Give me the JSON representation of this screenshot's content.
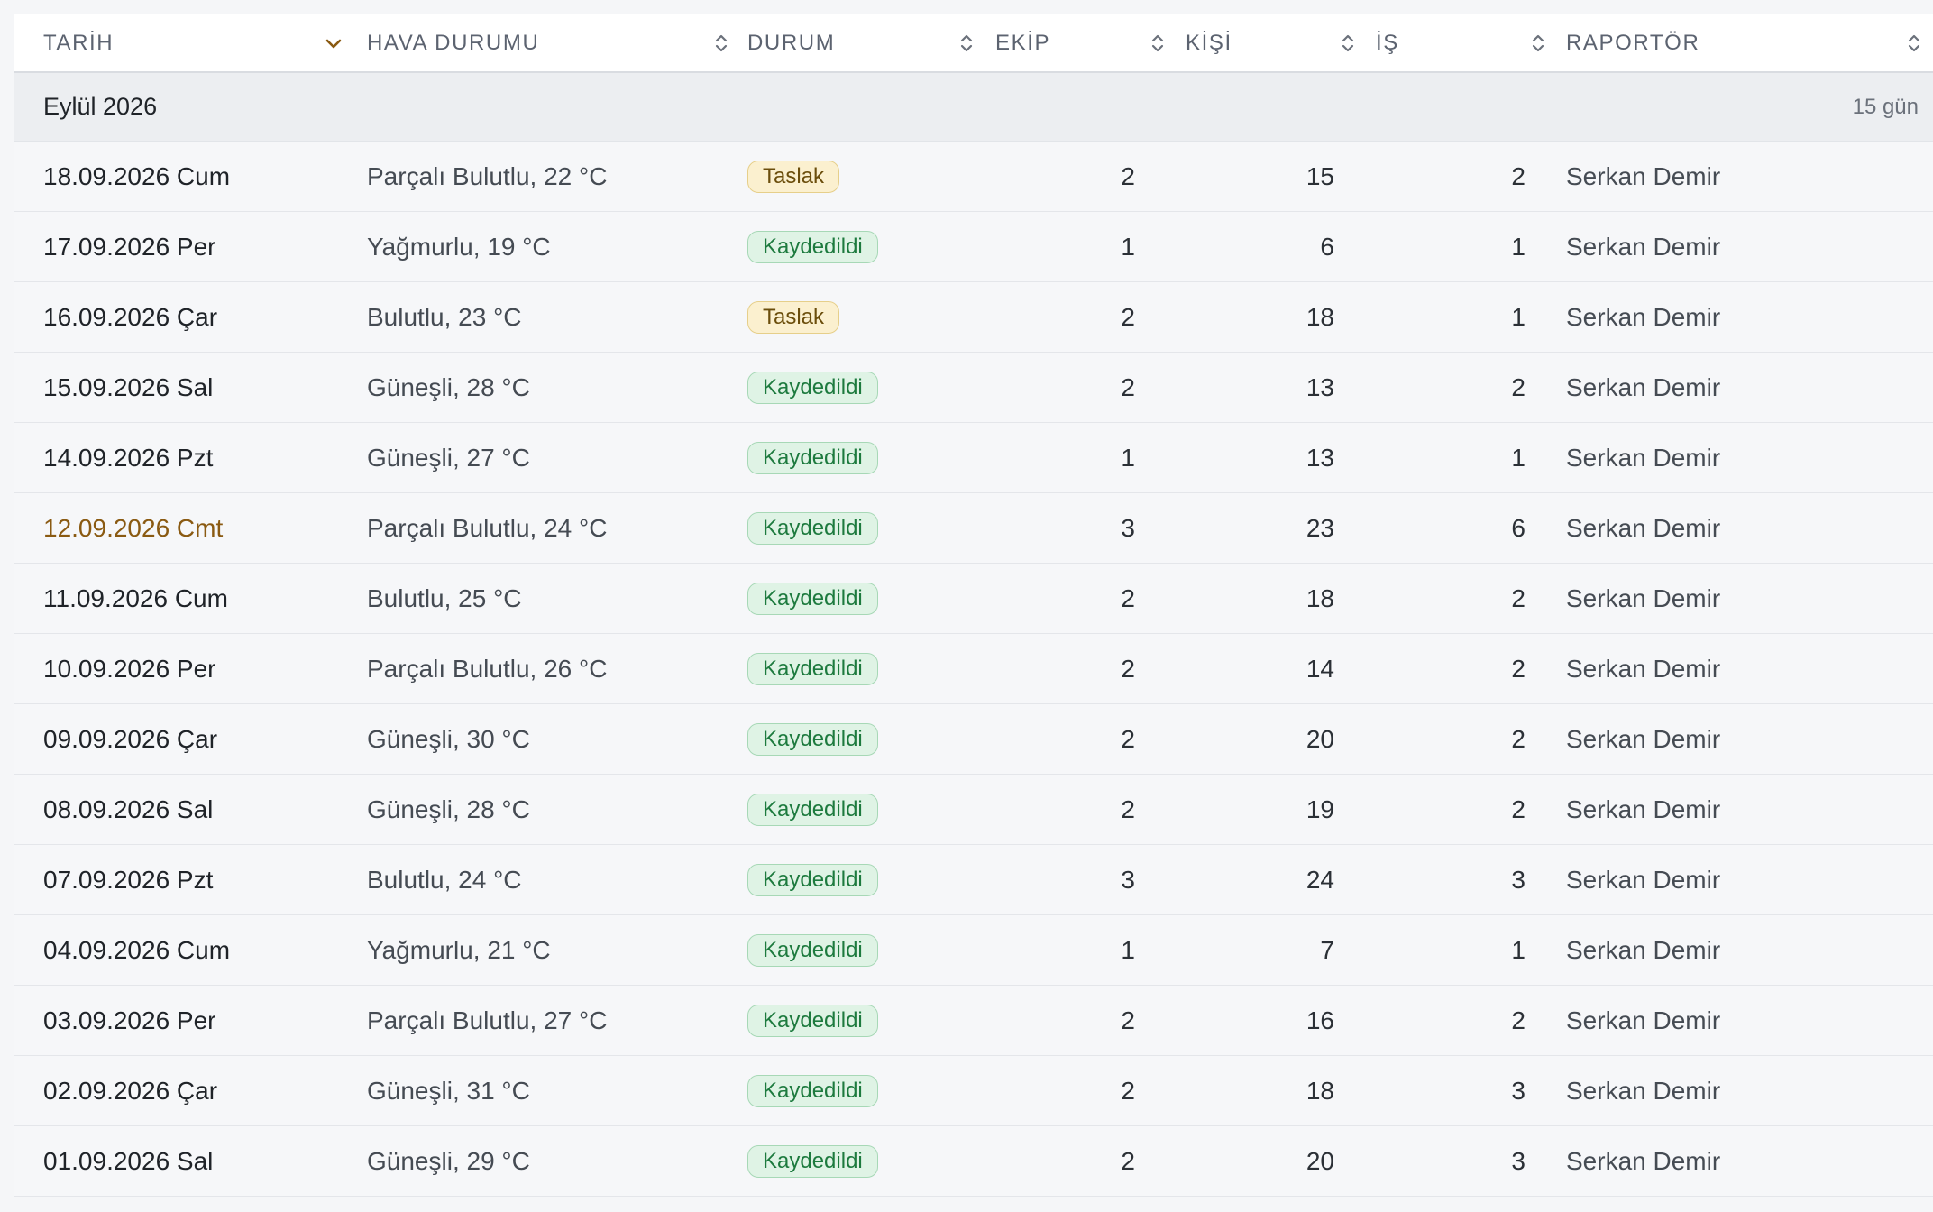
{
  "columns": {
    "date": "TARİH",
    "weather": "HAVA DURUMU",
    "status": "DURUM",
    "team": "EKİP",
    "people": "KİŞİ",
    "jobs": "İŞ",
    "reporter": "RAPORTÖR"
  },
  "group": {
    "title": "Eylül 2026",
    "count": "15 gün"
  },
  "colors": {
    "accent": "#8a5a12",
    "draft_badge": "#fbf0cf",
    "saved_badge": "#dff3e5"
  },
  "rows": [
    {
      "date": "18.09.2026 Cum",
      "weather": "Parçalı Bulutlu, 22 °C",
      "status": "Taslak",
      "team": "2",
      "people": "15",
      "jobs": "2",
      "reporter": "Serkan Demir"
    },
    {
      "date": "17.09.2026 Per",
      "weather": "Yağmurlu, 19 °C",
      "status": "Kaydedildi",
      "team": "1",
      "people": "6",
      "jobs": "1",
      "reporter": "Serkan Demir"
    },
    {
      "date": "16.09.2026 Çar",
      "weather": "Bulutlu, 23 °C",
      "status": "Taslak",
      "team": "2",
      "people": "18",
      "jobs": "1",
      "reporter": "Serkan Demir"
    },
    {
      "date": "15.09.2026 Sal",
      "weather": "Güneşli, 28 °C",
      "status": "Kaydedildi",
      "team": "2",
      "people": "13",
      "jobs": "2",
      "reporter": "Serkan Demir"
    },
    {
      "date": "14.09.2026 Pzt",
      "weather": "Güneşli, 27 °C",
      "status": "Kaydedildi",
      "team": "1",
      "people": "13",
      "jobs": "1",
      "reporter": "Serkan Demir"
    },
    {
      "date": "12.09.2026 Cmt",
      "weather": "Parçalı Bulutlu, 24 °C",
      "status": "Kaydedildi",
      "team": "3",
      "people": "23",
      "jobs": "6",
      "reporter": "Serkan Demir",
      "weekend": true
    },
    {
      "date": "11.09.2026 Cum",
      "weather": "Bulutlu, 25 °C",
      "status": "Kaydedildi",
      "team": "2",
      "people": "18",
      "jobs": "2",
      "reporter": "Serkan Demir"
    },
    {
      "date": "10.09.2026 Per",
      "weather": "Parçalı Bulutlu, 26 °C",
      "status": "Kaydedildi",
      "team": "2",
      "people": "14",
      "jobs": "2",
      "reporter": "Serkan Demir"
    },
    {
      "date": "09.09.2026 Çar",
      "weather": "Güneşli, 30 °C",
      "status": "Kaydedildi",
      "team": "2",
      "people": "20",
      "jobs": "2",
      "reporter": "Serkan Demir"
    },
    {
      "date": "08.09.2026 Sal",
      "weather": "Güneşli, 28 °C",
      "status": "Kaydedildi",
      "team": "2",
      "people": "19",
      "jobs": "2",
      "reporter": "Serkan Demir"
    },
    {
      "date": "07.09.2026 Pzt",
      "weather": "Bulutlu, 24 °C",
      "status": "Kaydedildi",
      "team": "3",
      "people": "24",
      "jobs": "3",
      "reporter": "Serkan Demir"
    },
    {
      "date": "04.09.2026 Cum",
      "weather": "Yağmurlu, 21 °C",
      "status": "Kaydedildi",
      "team": "1",
      "people": "7",
      "jobs": "1",
      "reporter": "Serkan Demir"
    },
    {
      "date": "03.09.2026 Per",
      "weather": "Parçalı Bulutlu, 27 °C",
      "status": "Kaydedildi",
      "team": "2",
      "people": "16",
      "jobs": "2",
      "reporter": "Serkan Demir"
    },
    {
      "date": "02.09.2026 Çar",
      "weather": "Güneşli, 31 °C",
      "status": "Kaydedildi",
      "team": "2",
      "people": "18",
      "jobs": "3",
      "reporter": "Serkan Demir"
    },
    {
      "date": "01.09.2026 Sal",
      "weather": "Güneşli, 29 °C",
      "status": "Kaydedildi",
      "team": "2",
      "people": "20",
      "jobs": "3",
      "reporter": "Serkan Demir"
    }
  ]
}
